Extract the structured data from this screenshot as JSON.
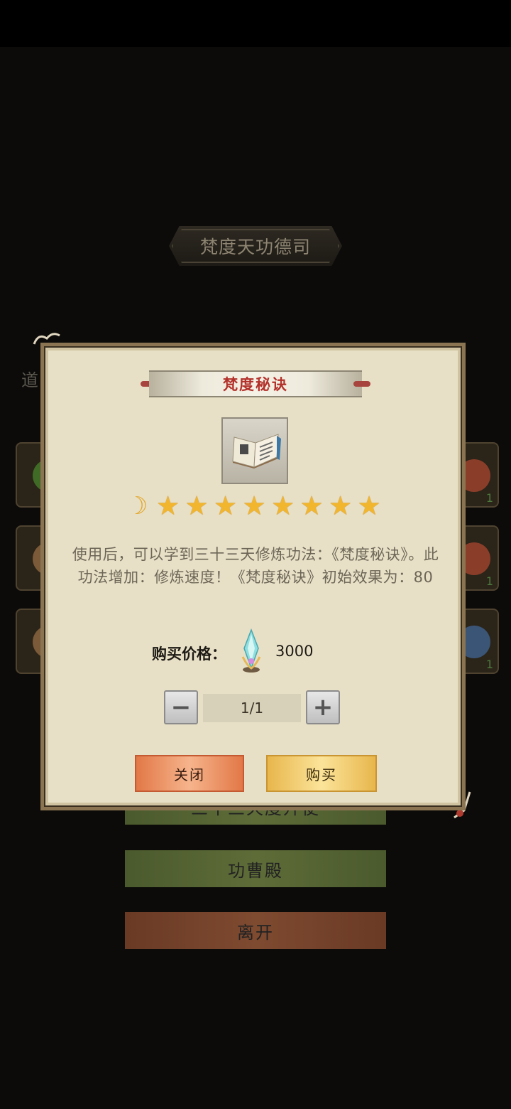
{
  "hall": {
    "title": "梵度天功德司",
    "side_label": "道"
  },
  "side_slots": {
    "right_counts": [
      "1",
      "1",
      "1"
    ]
  },
  "menu": {
    "hidden_label": "三十三天度升使",
    "merit_hall": "功曹殿",
    "leave": "离开"
  },
  "dialog": {
    "item_name": "梵度秘诀",
    "icon": "book-icon",
    "rating": {
      "moon": 1,
      "stars": 8
    },
    "description": "使用后，可以学到三十三天修炼功法：《梵度秘诀》。此功法增加：修炼速度！《梵度秘诀》初始效果为：80",
    "price_label": "购买价格：",
    "price_icon": "crystal-gem-icon",
    "price_value": "3000",
    "quantity": "1/1",
    "minus_symbol": "−",
    "plus_symbol": "+",
    "close_label": "关闭",
    "buy_label": "购买"
  },
  "colors": {
    "item_name": "#b3312b",
    "star": "#f2b62e",
    "close_button": "#e27847",
    "buy_button": "#fbe49a"
  }
}
